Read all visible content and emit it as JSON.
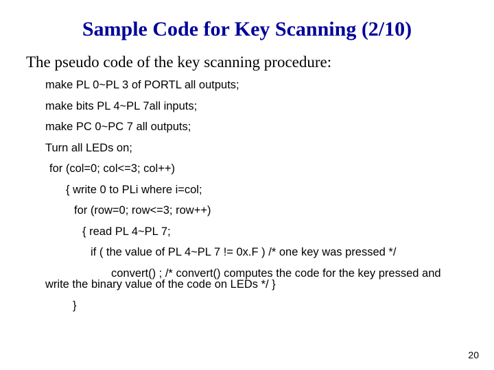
{
  "title": "Sample Code for Key Scanning (2/10)",
  "intro": "The pseudo code of the key scanning procedure:",
  "code": {
    "l1": "make PL 0~PL 3 of PORTL all outputs;",
    "l2": "make bits PL 4~PL 7all inputs;",
    "l3": "make PC 0~PC 7 all outputs;",
    "l4": "Turn all LEDs on;",
    "l5": "for (col=0; col<=3; col++)",
    "l6": "{  write 0 to PLi where i=col;",
    "l7": "for (row=0; row<=3; row++)",
    "l8": "{ read PL 4~PL 7;",
    "l9": "if ( the value of PL 4~PL 7 != 0x.F ) /* one key was pressed */",
    "l10": "convert() ; /* convert() computes the code for the key pressed and write the binary value of the code on LEDs */  }",
    "l11": "}"
  },
  "page_number": "20"
}
